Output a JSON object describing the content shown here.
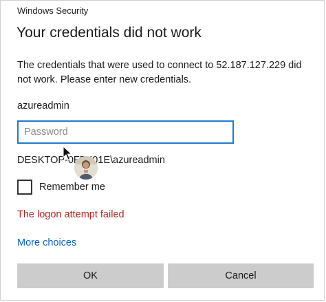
{
  "window": {
    "title": "Windows Security"
  },
  "dialog": {
    "heading": "Your credentials did not work",
    "message": "The credentials that were used to connect to 52.187.127.229 did not work. Please enter new credentials.",
    "username": "azureadmin",
    "password": {
      "value": "",
      "placeholder": "Password"
    },
    "domain_user": "DESKTOP-0FFK01E\\azureadmin",
    "remember_label": "Remember me",
    "remember_checked": false,
    "error_text": "The logon attempt failed",
    "more_choices": "More choices",
    "ok_label": "OK",
    "cancel_label": "Cancel"
  },
  "colors": {
    "accent": "#1f7ad2",
    "error": "#b3261e",
    "link": "#0a63c4",
    "button": "#cccccc"
  },
  "icons": {
    "cursor": "mouse-cursor-icon",
    "avatar": "user-avatar-icon"
  }
}
